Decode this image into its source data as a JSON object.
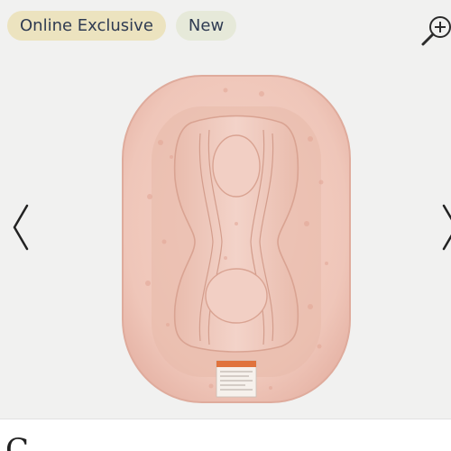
{
  "gallery": {
    "badges": [
      "Online Exclusive",
      "New"
    ],
    "zoom_icon": "zoom-in-icon",
    "prev_icon": "chevron-left-icon",
    "next_icon": "chevron-right-icon",
    "image": {
      "subject": "baby lounger",
      "colors": {
        "fabric": "#f0cbbf",
        "print": "#e2a595",
        "tag": "#e0733d"
      }
    }
  },
  "product": {
    "title_peek": "C"
  }
}
